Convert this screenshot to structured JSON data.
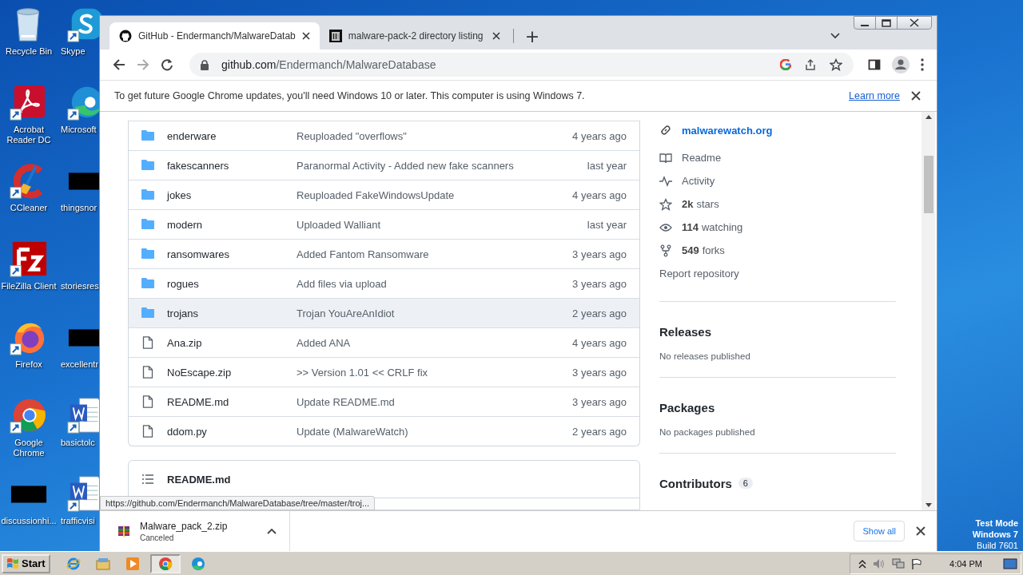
{
  "desktop": {
    "icons": [
      {
        "label": "Recycle Bin",
        "kind": "recycle"
      },
      {
        "label": "Skype",
        "kind": "skype"
      },
      {
        "label": "Acrobat Reader DC",
        "kind": "acrobat"
      },
      {
        "label": "Microsoft",
        "kind": "edge"
      },
      {
        "label": "CCleaner",
        "kind": "ccleaner"
      },
      {
        "label": "thingsnor",
        "kind": "redacted"
      },
      {
        "label": "FileZilla Client",
        "kind": "filezilla"
      },
      {
        "label": "storiesres",
        "kind": "blank"
      },
      {
        "label": "Firefox",
        "kind": "firefox"
      },
      {
        "label": "excellentr",
        "kind": "redacted"
      },
      {
        "label": "Google Chrome",
        "kind": "chrome"
      },
      {
        "label": "basictolc",
        "kind": "word"
      },
      {
        "label": "discussionhi...",
        "kind": "redacted"
      },
      {
        "label": "trafficvisi",
        "kind": "word"
      }
    ],
    "test_mode": [
      "Test Mode",
      "Windows 7",
      "Build 7601"
    ]
  },
  "browser": {
    "tabs": [
      {
        "title": "GitHub - Endermanch/MalwareDatab",
        "kind": "github",
        "selected": true
      },
      {
        "title": "malware-pack-2 directory listing",
        "kind": "archive",
        "selected": false
      }
    ],
    "new_tab": "+",
    "address": {
      "host": "github.com",
      "path": "/Endermanch/MalwareDatabase"
    },
    "infobar": {
      "message": "To get future Google Chrome updates, you'll need Windows 10 or later. This computer is using Windows 7.",
      "link": "Learn more"
    },
    "status_url": "https://github.com/Endermanch/MalwareDatabase/tree/master/troj...",
    "downloads": {
      "items": [
        {
          "file": "Malware_pack_2.zip",
          "status": "Canceled"
        }
      ],
      "show_all": "Show all"
    }
  },
  "repo": {
    "files": [
      {
        "name": "enderware",
        "kind": "folder",
        "message": "Reuploaded \"overflows\"",
        "age": "4 years ago",
        "hovered": false
      },
      {
        "name": "fakescanners",
        "kind": "folder",
        "message": "Paranormal Activity - Added new fake scanners",
        "age": "last year",
        "hovered": false
      },
      {
        "name": "jokes",
        "kind": "folder",
        "message": "Reuploaded FakeWindowsUpdate",
        "age": "4 years ago",
        "hovered": false
      },
      {
        "name": "modern",
        "kind": "folder",
        "message": "Uploaded Walliant",
        "age": "last year",
        "hovered": false
      },
      {
        "name": "ransomwares",
        "kind": "folder",
        "message": "Added Fantom Ransomware",
        "age": "3 years ago",
        "hovered": false
      },
      {
        "name": "rogues",
        "kind": "folder",
        "message": "Add files via upload",
        "age": "3 years ago",
        "hovered": false
      },
      {
        "name": "trojans",
        "kind": "folder",
        "message": "Trojan YouAreAnIdiot",
        "age": "2 years ago",
        "hovered": true
      },
      {
        "name": "Ana.zip",
        "kind": "file",
        "message": "Added ANA",
        "age": "4 years ago",
        "hovered": false
      },
      {
        "name": "NoEscape.zip",
        "kind": "file",
        "message": ">> Version 1.01 << CRLF fix",
        "age": "3 years ago",
        "hovered": false
      },
      {
        "name": "README.md",
        "kind": "file",
        "message": "Update README.md",
        "age": "3 years ago",
        "hovered": false
      },
      {
        "name": "ddom.py",
        "kind": "file",
        "message": "Update (MalwareWatch)",
        "age": "2 years ago",
        "hovered": false
      }
    ],
    "readme_title": "README.md",
    "sidebar": {
      "website": "malwarewatch.org",
      "links": [
        {
          "kind": "readme",
          "label": "Readme"
        },
        {
          "kind": "activity",
          "label": "Activity"
        },
        {
          "kind": "star",
          "count": "2k",
          "label": "stars"
        },
        {
          "kind": "eye",
          "count": "114",
          "label": "watching"
        },
        {
          "kind": "fork",
          "count": "549",
          "label": "forks"
        }
      ],
      "report": "Report repository",
      "sections": [
        {
          "title": "Releases",
          "note": "No releases published"
        },
        {
          "title": "Packages",
          "note": "No packages published"
        },
        {
          "title": "Contributors",
          "count": "6"
        }
      ]
    }
  },
  "taskbar": {
    "start": "Start",
    "apps": [
      {
        "kind": "ie",
        "active": false
      },
      {
        "kind": "explorer",
        "active": false
      },
      {
        "kind": "media",
        "active": false
      },
      {
        "kind": "chrome",
        "active": true
      },
      {
        "kind": "edge",
        "active": false
      }
    ],
    "clock": "4:04 PM"
  }
}
